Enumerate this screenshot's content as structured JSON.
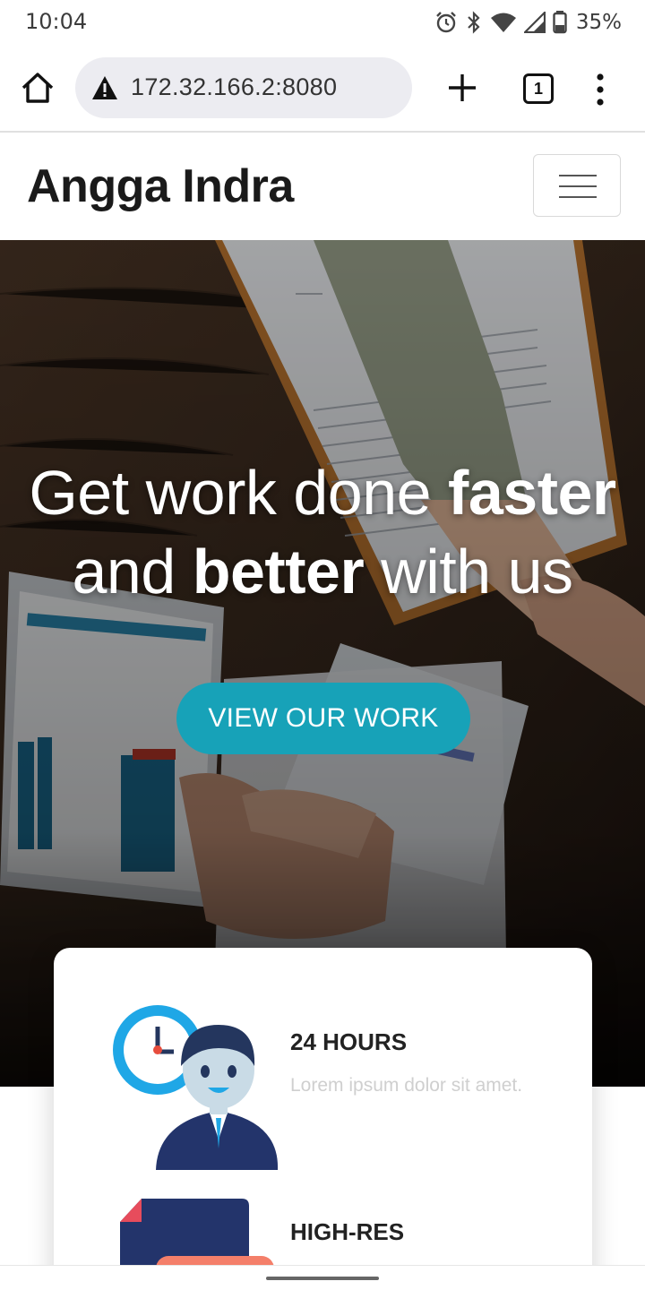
{
  "status_bar": {
    "time": "10:04",
    "battery": "35%",
    "icons": [
      "alarm-icon",
      "bluetooth-icon",
      "wifi-icon",
      "signal-icon",
      "battery-icon"
    ]
  },
  "browser": {
    "url": "172.32.166.2:8080",
    "tab_count": "1",
    "icons": [
      "home-icon",
      "not-secure-warning-icon",
      "new-tab-icon",
      "tab-switcher-icon",
      "more-menu-icon"
    ]
  },
  "site": {
    "brand": "Angga Indra",
    "hero": {
      "title_line1_regular": "Get work done ",
      "title_line1_bold": "faster",
      "title_line2_regular_a": "and ",
      "title_line2_bold": "better",
      "title_line2_regular_b": " with us",
      "cta": "VIEW OUR WORK"
    },
    "features": [
      {
        "title": "24 HOURS",
        "desc": "Lorem ipsum dolor sit amet.",
        "icon": "support-agent-clock-icon"
      },
      {
        "title": "HIGH-RES",
        "desc": "",
        "icon": "document-icon"
      }
    ]
  },
  "colors": {
    "accent": "#17a2b8",
    "brand_text": "#1a1a1a",
    "muted_text": "#cfcfcf"
  }
}
